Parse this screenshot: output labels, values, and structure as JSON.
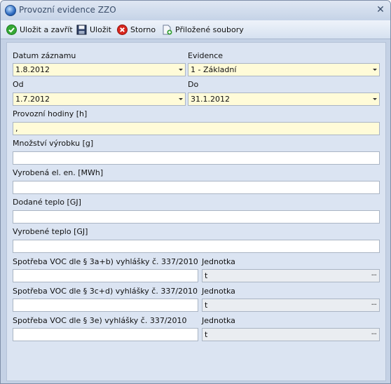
{
  "window": {
    "title": "Provozní evidence ZZO"
  },
  "toolbar": {
    "save_close": "Uložit a zavřít",
    "save": "Uložit",
    "cancel": "Storno",
    "attachments": "Přiložené soubory"
  },
  "form": {
    "record_date_label": "Datum záznamu",
    "record_date": "1.8.2012",
    "evidence_label": "Evidence",
    "evidence": "1 - Základní",
    "from_label": "Od",
    "from": "1.7.2012",
    "to_label": "Do",
    "to": "31.1.2012",
    "hours_label": "Provozní hodiny [h]",
    "hours": ",",
    "quantity_label": "Množství výrobku [g]",
    "quantity": "",
    "electricity_label": "Vyrobená el. en. [MWh]",
    "electricity": "",
    "heat_supplied_label": "Dodané teplo [GJ]",
    "heat_supplied": "",
    "heat_produced_label": "Vyrobené teplo [GJ]",
    "heat_produced": "",
    "voc": [
      {
        "label": "Spotřeba VOC dle § 3a+b) vyhlášky č. 337/2010",
        "value": "",
        "unit_label": "Jednotka",
        "unit": "t"
      },
      {
        "label": "Spotřeba VOC dle § 3c+d) vyhlášky č. 337/2010",
        "value": "",
        "unit_label": "Jednotka",
        "unit": "t"
      },
      {
        "label": "Spotřeba VOC dle § 3e) vyhlášky č. 337/2010",
        "value": "",
        "unit_label": "Jednotka",
        "unit": "t"
      }
    ]
  }
}
